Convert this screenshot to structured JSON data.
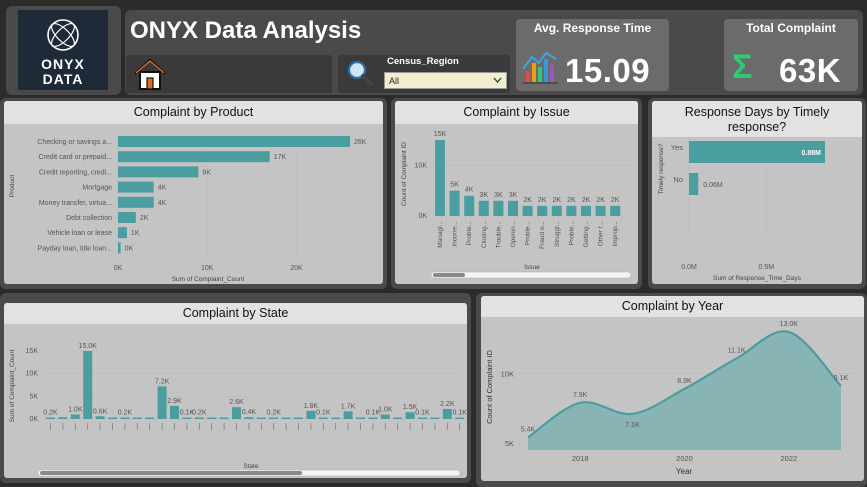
{
  "header": {
    "logo_line1": "ONYX",
    "logo_line2": "DATA",
    "title": "ONYX Data Analysis",
    "filter_label": "Census_Region",
    "filter_value": "All",
    "kpi1_label": "Avg. Response Time",
    "kpi1_value": "15.09",
    "kpi2_label": "Total Complaint",
    "kpi2_value": "63K",
    "kpi2_symbol": "Σ"
  },
  "colors": {
    "bar": "#4a9ea0",
    "panel": "#4a4a4a",
    "card": "#c4c4c4",
    "title_bg": "#e2e2e2",
    "accent_green": "#2ecc71"
  },
  "icons": {
    "logo": "globe-logo-icon",
    "home": "home-icon",
    "search": "search-icon",
    "chart": "bar-chart-icon",
    "sigma": "sigma-icon"
  },
  "chart_data": [
    {
      "id": "product",
      "type": "bar",
      "orientation": "horizontal",
      "title": "Complaint by Product",
      "ylabel": "Product",
      "xlabel": "Sum of Complaint_Count",
      "categories": [
        "Checking or savings a...",
        "Credit card or prepaid...",
        "Credit reporting, credi...",
        "Mortgage",
        "Money transfer, virtua...",
        "Debt collection",
        "Vehicle loan or lease",
        "Payday loan, title loan..."
      ],
      "values": [
        26000,
        17000,
        9000,
        4000,
        4000,
        2000,
        1000,
        300
      ],
      "data_labels": [
        "26K",
        "17K",
        "9K",
        "4K",
        "4K",
        "2K",
        "1K",
        "0K"
      ],
      "x_ticks": [
        "0K",
        "10K",
        "20K"
      ],
      "xlim": [
        0,
        26000
      ]
    },
    {
      "id": "issue",
      "type": "bar",
      "title": "Complaint by Issue",
      "ylabel": "Count of Complaint ID",
      "xlabel": "Issue",
      "categories": [
        "Managi...",
        "Incorre...",
        "Proble...",
        "Closing...",
        "Trouble...",
        "Openin...",
        "Proble...",
        "Fraud o...",
        "Struggl...",
        "Proble...",
        "Getting...",
        "Other f...",
        "Improp..."
      ],
      "values": [
        15000,
        5000,
        4000,
        3000,
        3000,
        3000,
        2000,
        2000,
        2000,
        2000,
        2000,
        2000,
        2000
      ],
      "data_labels": [
        "15K",
        "5K",
        "4K",
        "3K",
        "3K",
        "3K",
        "2K",
        "2K",
        "2K",
        "2K",
        "2K",
        "2K",
        "2K"
      ],
      "y_ticks": [
        "0K",
        "10K"
      ],
      "ylim": [
        0,
        15000
      ]
    },
    {
      "id": "timely",
      "type": "bar",
      "orientation": "horizontal",
      "title": "Response Days by Timely response?",
      "ylabel": "Timely response?",
      "xlabel": "Sum of Response_Time_Days",
      "categories": [
        "Yes",
        "No"
      ],
      "values": [
        0.88,
        0.06
      ],
      "data_labels": [
        "0.88M",
        "0.06M"
      ],
      "x_ticks": [
        "0.0M",
        "0.5M"
      ],
      "xlim": [
        0,
        0.88
      ]
    },
    {
      "id": "state",
      "type": "bar",
      "title": "Complaint by State",
      "ylabel": "Sum of Complaint_Count",
      "xlabel": "State",
      "values": [
        0.2,
        0.4,
        1.0,
        15.0,
        0.6,
        0.3,
        0.2,
        0.1,
        0.1,
        7.2,
        2.9,
        0.1,
        0.2,
        0.1,
        0.2,
        2.6,
        0.4,
        0.3,
        0.2,
        0.1,
        0.1,
        1.8,
        0.1,
        0.1,
        1.7,
        0.3,
        0.1,
        1.0,
        0.2,
        1.5,
        0.1,
        0.1,
        2.2,
        0.1
      ],
      "data_labels": [
        "0.2K",
        "",
        "1.0K",
        "15.0K",
        "0.6K",
        "",
        "0.2K",
        "",
        "",
        "7.2K",
        "2.9K",
        "0.1K",
        "0.2K",
        "",
        "",
        "2.6K",
        "0.4K",
        "",
        "0.2K",
        "",
        "",
        "1.8K",
        "0.1K",
        "",
        "1.7K",
        "",
        "0.1K",
        "1.0K",
        "",
        "1.5K",
        "0.1K",
        "",
        "2.2K",
        "0.1K"
      ],
      "y_ticks": [
        "0K",
        "5K",
        "10K",
        "15K"
      ],
      "ylim": [
        0,
        15
      ]
    },
    {
      "id": "year",
      "type": "area",
      "title": "Complaint by Year",
      "ylabel": "Count of Complaint ID",
      "xlabel": "Year",
      "x": [
        2017,
        2018,
        2019,
        2020,
        2021,
        2022,
        2023
      ],
      "values": [
        5.4,
        7.9,
        7.1,
        8.9,
        11.1,
        13.0,
        9.1
      ],
      "data_labels": [
        "5.4K",
        "7.9K",
        "7.1K",
        "8.9K",
        "11.1K",
        "13.0K",
        "9.1K"
      ],
      "x_ticks": [
        "2018",
        "2020",
        "2022"
      ],
      "y_ticks": [
        "5K",
        "10K"
      ],
      "ylim": [
        4.5,
        13.5
      ]
    }
  ]
}
